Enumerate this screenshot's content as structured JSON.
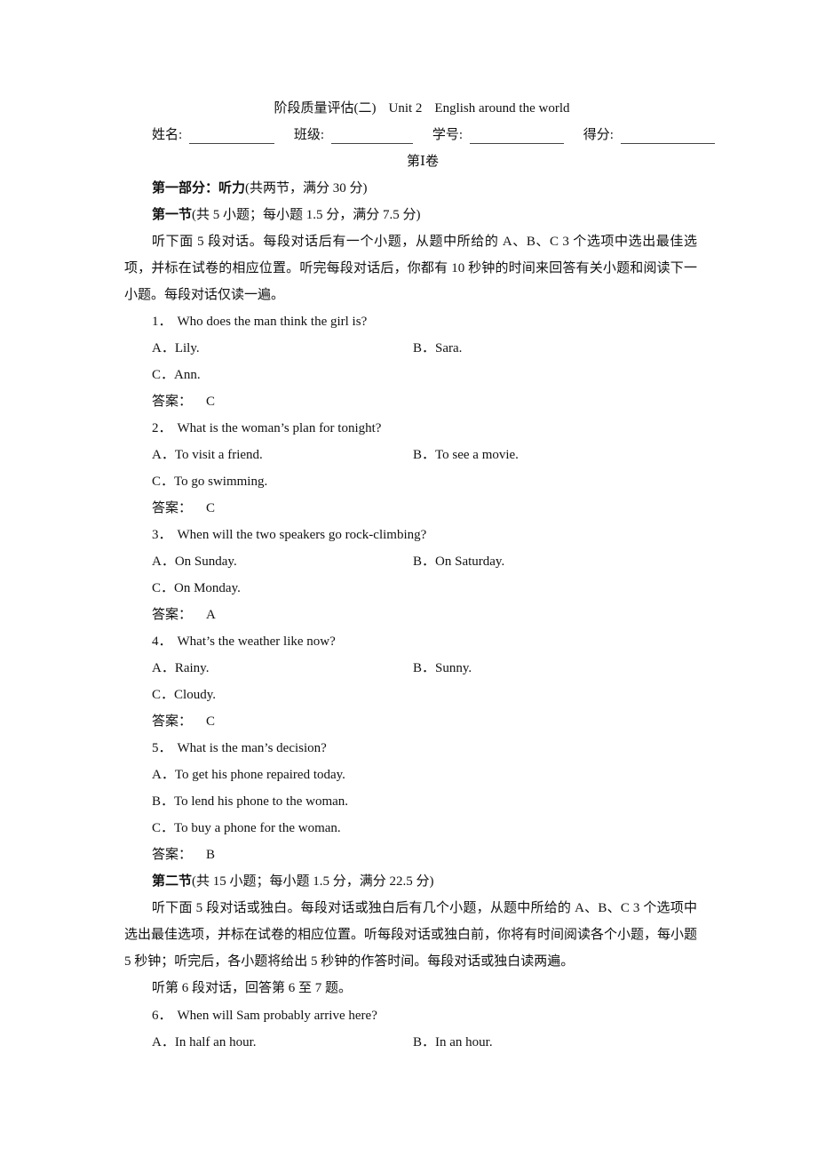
{
  "header": {
    "title_cn": "阶段质量评估(二)",
    "title_unit": "Unit 2",
    "title_en": "English around the world",
    "fields": [
      {
        "label": "姓名:",
        "value": ""
      },
      {
        "label": "班级:",
        "value": ""
      },
      {
        "label": "学号:",
        "value": ""
      },
      {
        "label": "得分:",
        "value": ""
      }
    ],
    "volume": "第Ⅰ卷"
  },
  "part1": {
    "heading_bold": "第一部分：听力",
    "heading_rest": "(共两节，满分 30 分)",
    "section1": {
      "heading_bold": "第一节",
      "heading_rest": "(共 5 小题；每小题 1.5 分，满分 7.5 分)",
      "instructions": "听下面 5 段对话。每段对话后有一个小题，从题中所给的 A、B、C 3 个选项中选出最佳选项，并标在试卷的相应位置。听完每段对话后，你都有 10 秒钟的时间来回答有关小题和阅读下一小题。每段对话仅读一遍。"
    },
    "answer_label": "答案：",
    "questions": [
      {
        "number": "1．",
        "text": "Who does the man think the girl is?",
        "options": [
          {
            "letter": "A．",
            "text": "Lily."
          },
          {
            "letter": "B．",
            "text": "Sara."
          },
          {
            "letter": "C．",
            "text": "Ann."
          }
        ],
        "answer": "C"
      },
      {
        "number": "2．",
        "text": "What is the woman’s plan for tonight?",
        "options": [
          {
            "letter": "A．",
            "text": "To visit a friend."
          },
          {
            "letter": "B．",
            "text": "To see a movie."
          },
          {
            "letter": "C．",
            "text": "To go swimming."
          }
        ],
        "answer": "C"
      },
      {
        "number": "3．",
        "text": "When will the two speakers go rock-climbing?",
        "options": [
          {
            "letter": "A．",
            "text": "On Sunday."
          },
          {
            "letter": "B．",
            "text": "On Saturday."
          },
          {
            "letter": "C．",
            "text": "On Monday."
          }
        ],
        "answer": "A"
      },
      {
        "number": "4．",
        "text": "What’s the weather like now?",
        "options": [
          {
            "letter": "A．",
            "text": "Rainy."
          },
          {
            "letter": "B．",
            "text": "Sunny."
          },
          {
            "letter": "C．",
            "text": "Cloudy."
          }
        ],
        "answer": "C"
      },
      {
        "number": "5．",
        "text": "What is the man’s decision?",
        "options": [
          {
            "letter": "A．",
            "text": "To get his phone repaired today."
          },
          {
            "letter": "B．",
            "text": "To lend his phone to the woman."
          },
          {
            "letter": "C．",
            "text": "To buy a phone for the woman."
          }
        ],
        "answer": "B"
      }
    ],
    "section2": {
      "heading_bold": "第二节",
      "heading_rest": "(共 15 小题；每小题 1.5 分，满分 22.5 分)",
      "instructions": "听下面 5 段对话或独白。每段对话或独白后有几个小题，从题中所给的 A、B、C 3 个选项中选出最佳选项，并标在试卷的相应位置。听每段对话或独白前，你将有时间阅读各个小题，每小题 5 秒钟；听完后，各小题将给出 5 秒钟的作答时间。每段对话或独白读两遍。",
      "dialogue_intro": "听第 6 段对话，回答第 6 至 7 题。",
      "questions": [
        {
          "number": "6．",
          "text": "When will Sam probably arrive here?",
          "options": [
            {
              "letter": "A．",
              "text": "In half an hour."
            },
            {
              "letter": "B．",
              "text": "In an hour."
            }
          ]
        }
      ]
    }
  }
}
